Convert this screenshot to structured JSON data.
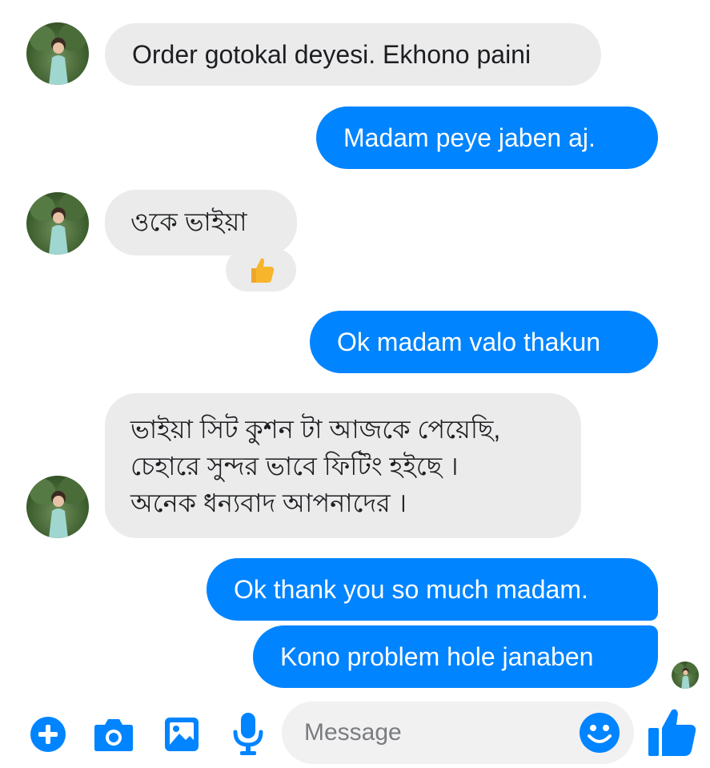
{
  "conversation": {
    "messages": [
      {
        "from": "contact",
        "text": "Order gotokal deyesi. Ekhono paini"
      },
      {
        "from": "me",
        "text": "Madam peye jaben aj."
      },
      {
        "from": "contact",
        "text": "ওকে ভাইয়া",
        "reaction": "thumbs-up"
      },
      {
        "from": "me",
        "text": "Ok madam valo thakun"
      },
      {
        "from": "contact",
        "lines": [
          "ভাইয়া সিট কুশন টা আজকে পেয়েছি,",
          "চেহারে সুন্দর ভাবে ফিটিং হইছে ।",
          "অনেক ধন্যবাদ আপনাদের ।"
        ]
      },
      {
        "from": "me",
        "text": "Ok thank you so much madam."
      },
      {
        "from": "me",
        "text": "Kono problem hole janaben"
      }
    ]
  },
  "composer": {
    "placeholder": "Message",
    "icons": [
      "plus-icon",
      "camera-icon",
      "image-icon",
      "microphone-icon",
      "emoji-icon",
      "like-icon"
    ]
  },
  "colors": {
    "outgoing_bubble": "#0084ff",
    "incoming_bubble": "#ebebeb",
    "accent": "#0084ff"
  }
}
